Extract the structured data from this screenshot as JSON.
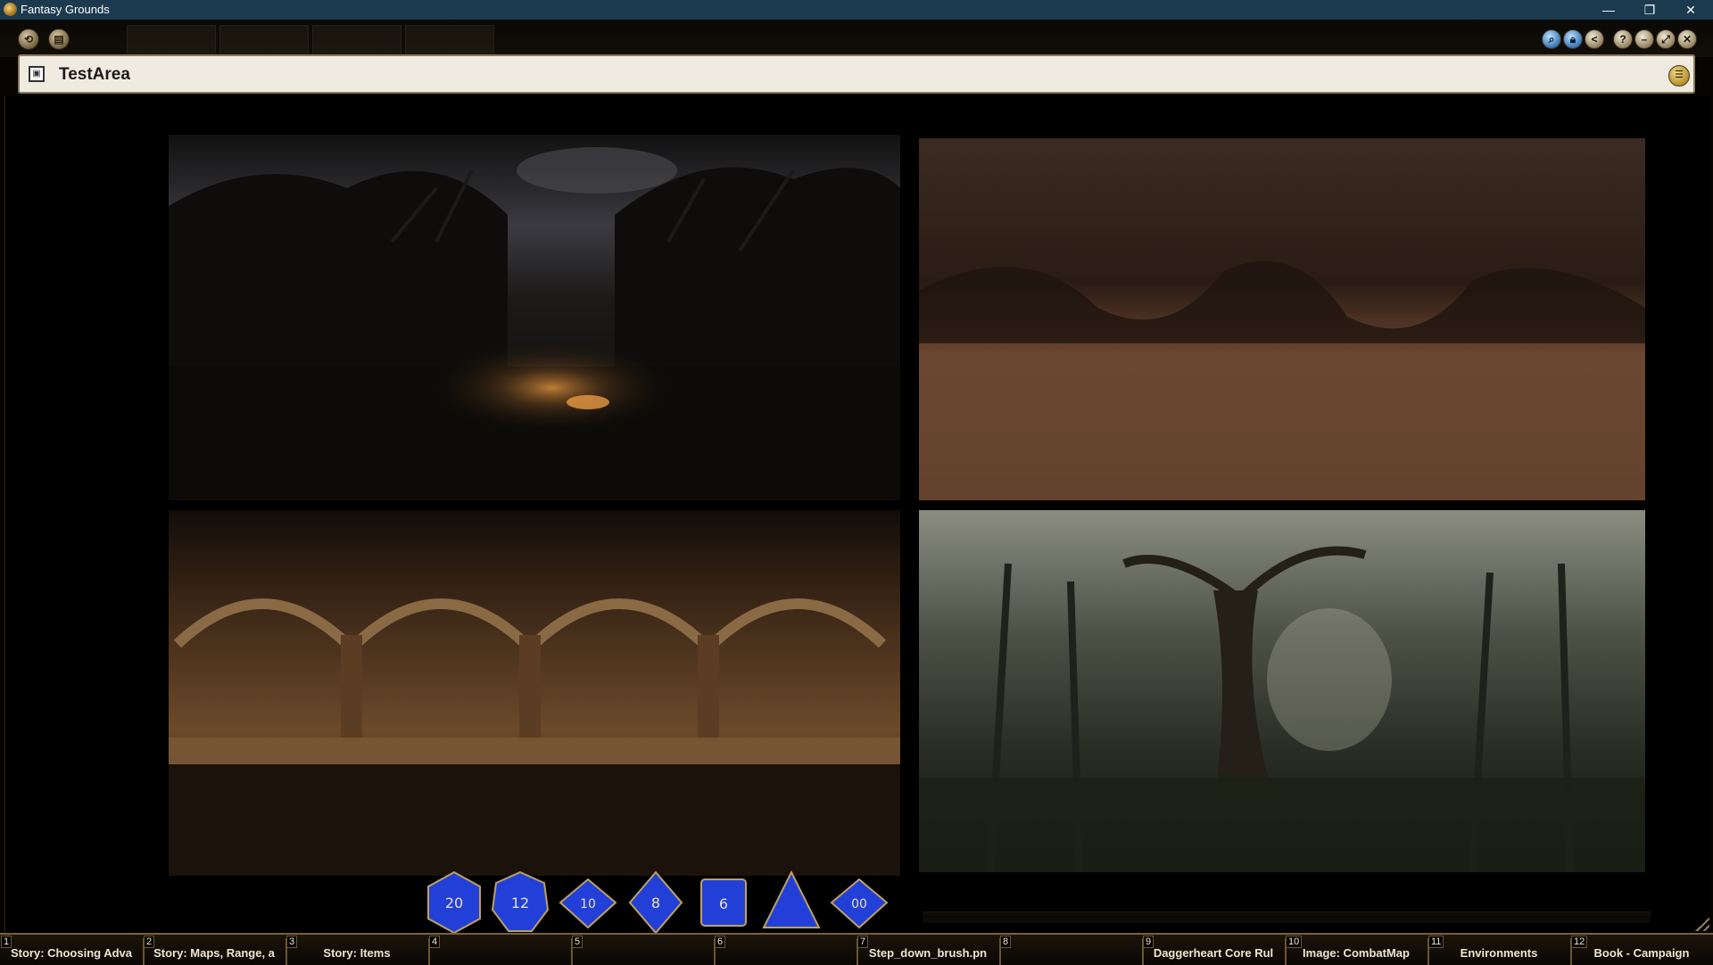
{
  "os": {
    "title": "Fantasy Grounds",
    "minimize": "—",
    "restore": "❐",
    "close": "✕"
  },
  "toolbar": {
    "buttons": [
      "sidebar-toggle",
      "library"
    ],
    "right_icons": [
      "search-icon",
      "lock-icon",
      "share-icon",
      "help-icon",
      "minimize-icon",
      "maximize-icon",
      "close-icon"
    ]
  },
  "window": {
    "title": "TestArea",
    "link_icon": "link-icon",
    "menu_icon": "menu-icon"
  },
  "panels": [
    {
      "name": "dark-forest-path",
      "scene": "forest-night"
    },
    {
      "name": "cave-dirt",
      "scene": "cave"
    },
    {
      "name": "dungeon-arches",
      "scene": "arches"
    },
    {
      "name": "misty-forest",
      "scene": "misty-forest"
    }
  ],
  "dice": [
    {
      "name": "d20",
      "label": "20"
    },
    {
      "name": "d12",
      "label": "12"
    },
    {
      "name": "d10",
      "label": "10"
    },
    {
      "name": "d8",
      "label": "8"
    },
    {
      "name": "d6",
      "label": "6"
    },
    {
      "name": "d4",
      "label": ""
    },
    {
      "name": "d100",
      "label": "00"
    }
  ],
  "hotkeys": [
    {
      "num": "1",
      "label": "Story: Choosing Adva"
    },
    {
      "num": "2",
      "label": "Story: Maps, Range, a"
    },
    {
      "num": "3",
      "label": "Story: Items"
    },
    {
      "num": "4",
      "label": ""
    },
    {
      "num": "5",
      "label": ""
    },
    {
      "num": "6",
      "label": ""
    },
    {
      "num": "7",
      "label": "Step_down_brush.pn"
    },
    {
      "num": "8",
      "label": ""
    },
    {
      "num": "9",
      "label": "Daggerheart Core Rul"
    },
    {
      "num": "10",
      "label": "Image: CombatMap"
    },
    {
      "num": "11",
      "label": "Environments"
    },
    {
      "num": "12",
      "label": "Book - Campaign"
    }
  ],
  "colors": {
    "accent": "#7a6236",
    "die_blue": "#1f3fd0",
    "header_bg": "#f0ebe1"
  }
}
